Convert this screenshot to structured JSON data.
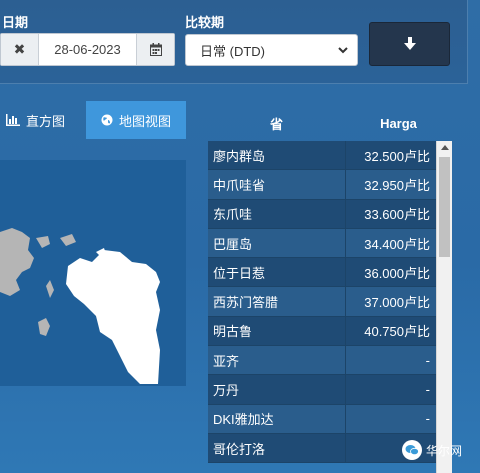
{
  "filters": {
    "date_label": "日期",
    "date_value": "28-06-2023",
    "compare_label": "比较期",
    "compare_value": "日常 (DTD)"
  },
  "tabs": [
    {
      "label": "直方图",
      "icon": "bar-chart-icon",
      "active": false
    },
    {
      "label": "地图视图",
      "icon": "globe-icon",
      "active": true
    }
  ],
  "table": {
    "headers": [
      "省",
      "Harga"
    ],
    "rows": [
      {
        "province": "廖内群岛",
        "price": "32.500卢比"
      },
      {
        "province": "中爪哇省",
        "price": "32.950卢比"
      },
      {
        "province": "东爪哇",
        "price": "33.600卢比"
      },
      {
        "province": "巴厘岛",
        "price": "34.400卢比"
      },
      {
        "province": "位于日惹",
        "price": "36.000卢比"
      },
      {
        "province": "西苏门答腊",
        "price": "37.000卢比"
      },
      {
        "province": "明古鲁",
        "price": "40.750卢比"
      },
      {
        "province": "亚齐",
        "price": "-"
      },
      {
        "province": "万丹",
        "price": "-"
      },
      {
        "province": "DKI雅加达",
        "price": "-"
      },
      {
        "province": "哥伦打洛",
        "price": ""
      }
    ]
  },
  "watermark": {
    "text": "华尔网"
  },
  "colors": {
    "accent": "#3f97dc",
    "button_dark": "#24364d"
  }
}
